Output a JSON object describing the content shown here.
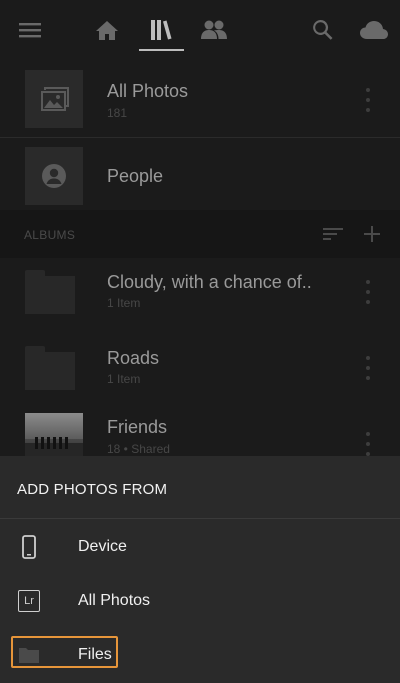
{
  "topbar": {
    "icons": [
      "menu-icon",
      "home-icon",
      "library-icon",
      "people-icon",
      "search-icon",
      "cloud-icon"
    ],
    "active_tab": "library-icon"
  },
  "library": {
    "all_photos": {
      "title": "All Photos",
      "count": "181"
    },
    "people": {
      "title": "People"
    }
  },
  "albums": {
    "section_label": "ALBUMS",
    "items": [
      {
        "title": "Cloudy, with a chance of..",
        "subtitle": "1 Item"
      },
      {
        "title": "Roads",
        "subtitle": "1 Item"
      },
      {
        "title": "Friends",
        "subtitle": "18 • Shared"
      }
    ]
  },
  "sheet": {
    "title": "ADD PHOTOS FROM",
    "options": [
      {
        "label": "Device",
        "icon": "phone-icon"
      },
      {
        "label": "All Photos",
        "icon": "lr-icon",
        "icon_text": "Lr"
      },
      {
        "label": "Files",
        "icon": "folder-icon"
      }
    ],
    "highlight_color": "#e6953a"
  }
}
